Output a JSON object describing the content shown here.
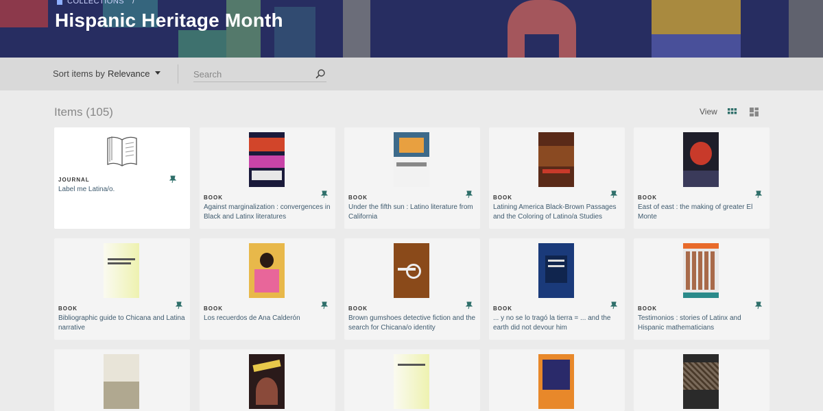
{
  "breadcrumb": {
    "label": "Collections",
    "separator": "/"
  },
  "page": {
    "title": "Hispanic Heritage Month"
  },
  "toolbar": {
    "sort_label": "Sort items by",
    "sort_value": "Relevance",
    "search_placeholder": "Search"
  },
  "items_header": {
    "count_label": "Items (105)",
    "view_label": "View"
  },
  "icons": {
    "home": "home-icon",
    "search": "search-icon",
    "grid": "grid-view-icon",
    "list": "list-view-icon",
    "pin": "pin-icon",
    "caret": "caret-down-icon",
    "journal": "open-book-icon"
  },
  "colors": {
    "banner": "#2b3168",
    "accent": "#2f6f6a",
    "title_text": "#3e5a6e"
  },
  "items": [
    {
      "type": "JOURNAL",
      "title": "Label me Latina/o."
    },
    {
      "type": "BOOK",
      "title": "Against marginalization : convergences in Black and Latinx literatures"
    },
    {
      "type": "BOOK",
      "title": "Under the fifth sun : Latino literature from California"
    },
    {
      "type": "BOOK",
      "title": "Latining America Black-Brown Passages and the Coloring of Latino/a Studies"
    },
    {
      "type": "BOOK",
      "title": "East of east : the making of greater El Monte"
    },
    {
      "type": "BOOK",
      "title": "Bibliographic guide to Chicana and Latina narrative"
    },
    {
      "type": "BOOK",
      "title": "Los recuerdos de Ana Calderón"
    },
    {
      "type": "BOOK",
      "title": "Brown gumshoes detective fiction and the search for Chicana/o identity"
    },
    {
      "type": "BOOK",
      "title": "... y no se lo tragó la tierra = ... and the earth did not devour him"
    },
    {
      "type": "BOOK",
      "title": "Testimonios : stories of Latinx and Hispanic mathematicians"
    }
  ]
}
